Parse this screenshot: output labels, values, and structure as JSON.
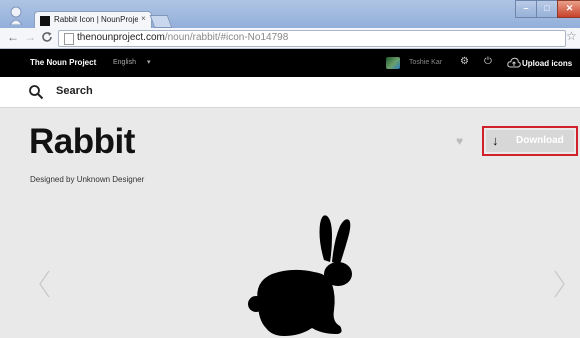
{
  "browser": {
    "tab_title": "Rabbit Icon | NounProject",
    "tab_close": "×",
    "window_buttons": {
      "minimize": "–",
      "maximize": "□",
      "close": "✕"
    },
    "nav": {
      "back": "←",
      "forward": "→",
      "reload": "C"
    },
    "url_host": "thenounproject.com",
    "url_path": "/noun/rabbit/#icon-No14798",
    "star": "☆"
  },
  "site_header": {
    "brand": "The Noun Project",
    "language": "English",
    "language_caret": "▾",
    "username": "Toshie Kar",
    "gear": "⚙",
    "power": "⏻",
    "upload_label": "Upload icons"
  },
  "search": {
    "label": "Search"
  },
  "icon_page": {
    "title": "Rabbit",
    "designer": "Designed by Unknown Designer",
    "heart": "♥",
    "download_arrow": "↓",
    "download_label": "Download"
  },
  "colors": {
    "download_highlight": "#d0202a",
    "header_bg": "#000000",
    "page_bg": "#e9e9e9"
  }
}
